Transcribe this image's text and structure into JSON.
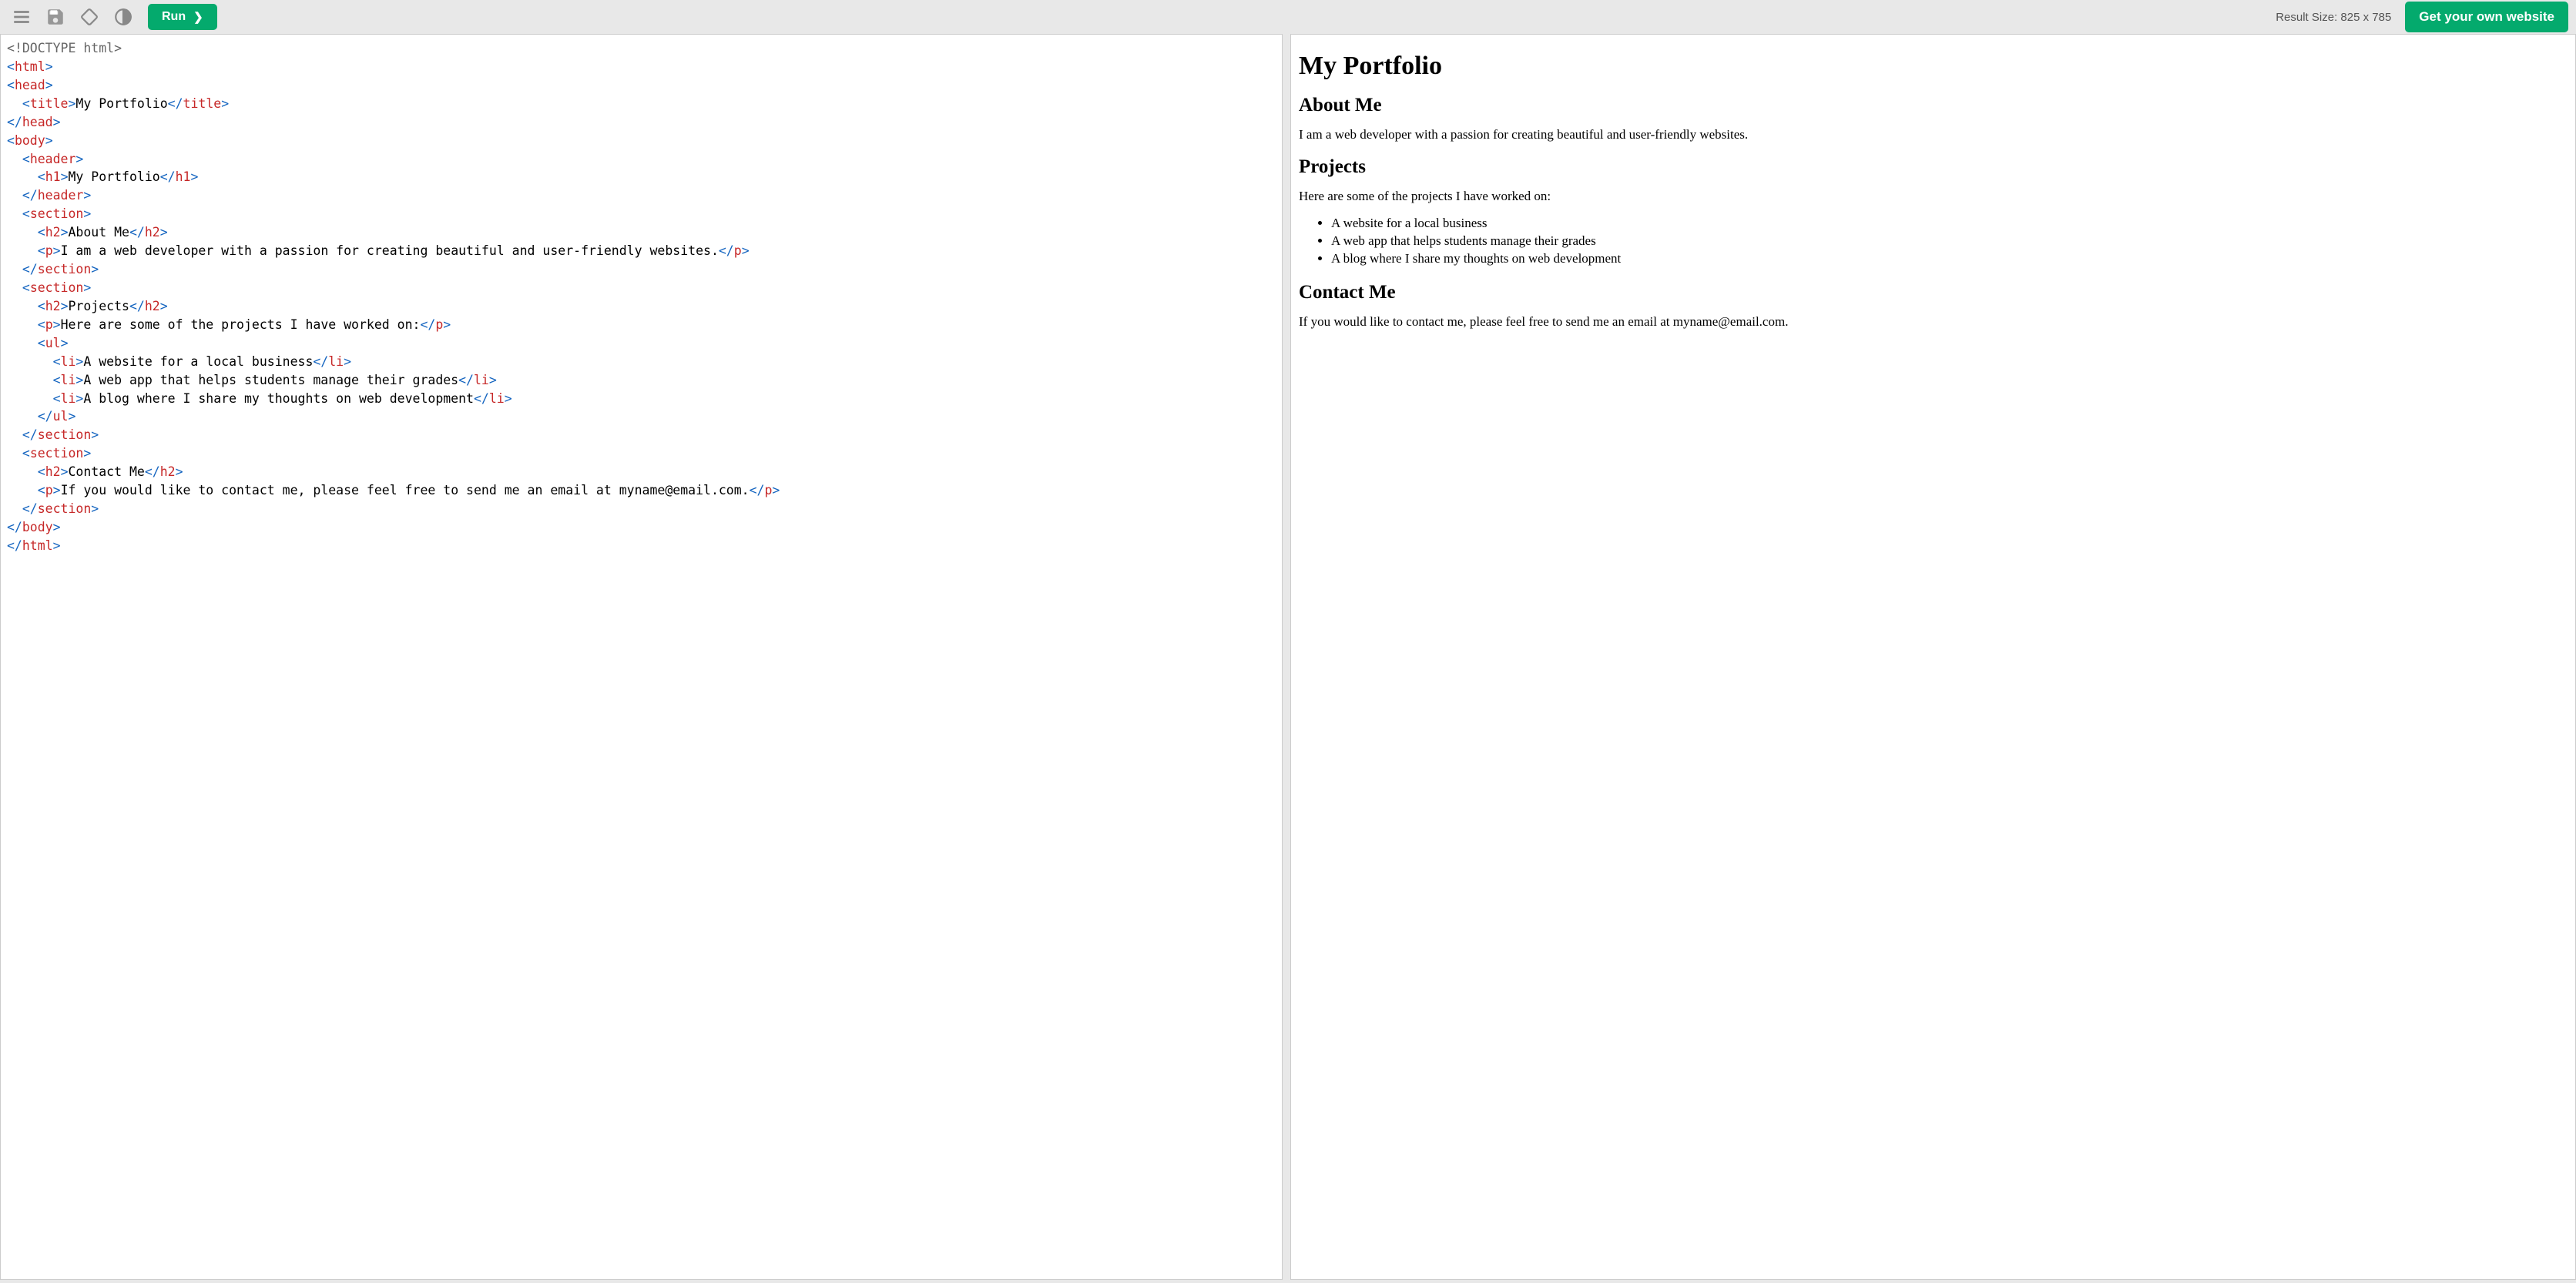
{
  "toolbar": {
    "run_label": "Run",
    "result_size_label": "Result Size: 825 x 785",
    "get_website_label": "Get your own website"
  },
  "code": {
    "doctype": "<!DOCTYPE html>",
    "title_text": "My Portfolio",
    "h1_text": "My Portfolio",
    "section1": {
      "h2": "About Me",
      "p": "I am a web developer with a passion for creating beautiful and user-friendly websites."
    },
    "section2": {
      "h2": "Projects",
      "p": "Here are some of the projects I have worked on:",
      "li1": "A website for a local business",
      "li2": "A web app that helps students manage their grades",
      "li3": "A blog where I share my thoughts on web development"
    },
    "section3": {
      "h2": "Contact Me",
      "p": "If you would like to contact me, please feel free to send me an email at myname@email.com."
    }
  },
  "preview": {
    "h1": "My Portfolio",
    "about": {
      "h2": "About Me",
      "p": "I am a web developer with a passion for creating beautiful and user-friendly websites."
    },
    "projects": {
      "h2": "Projects",
      "p": "Here are some of the projects I have worked on:",
      "items": [
        "A website for a local business",
        "A web app that helps students manage their grades",
        "A blog where I share my thoughts on web development"
      ]
    },
    "contact": {
      "h2": "Contact Me",
      "p": "If you would like to contact me, please feel free to send me an email at myname@email.com."
    }
  }
}
